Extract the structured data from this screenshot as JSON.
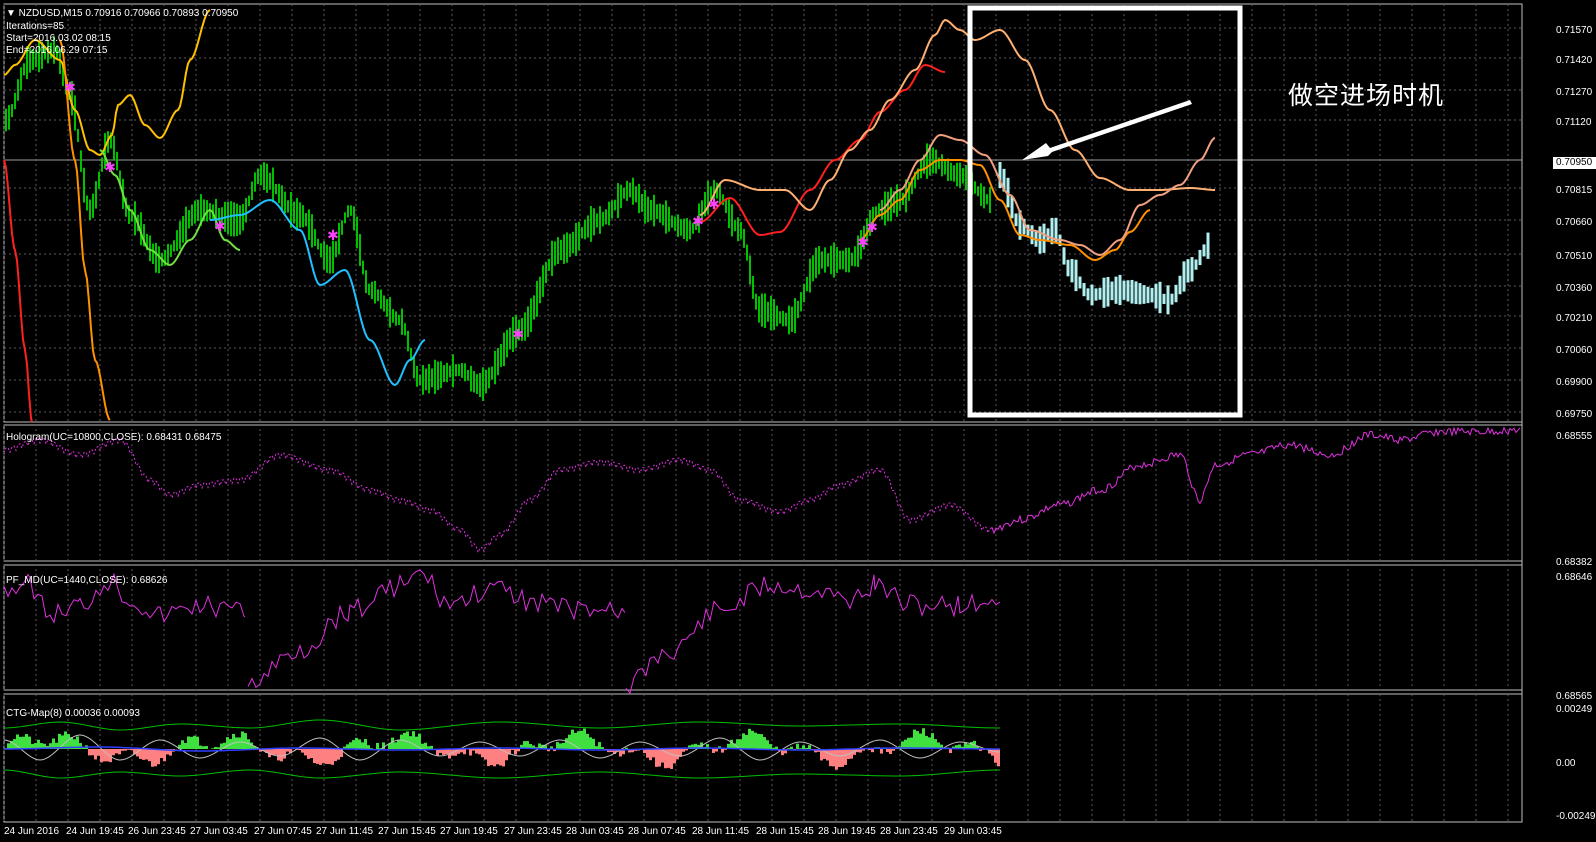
{
  "main": {
    "symbol_header": "▼ NZDUSD,M15  0.70916 0.70966 0.70893 0.70950",
    "iterations": "Iterations=85",
    "start": "Start=2016.03.02 08:15",
    "end": "End=2016.06.29 07:15",
    "price_labels": [
      "0.71570",
      "0.71420",
      "0.71270",
      "0.71120",
      "0.70950",
      "0.70815",
      "0.70660",
      "0.70510",
      "0.70360",
      "0.70210",
      "0.70060",
      "0.69900",
      "0.69750"
    ],
    "current_price": "0.70950",
    "annotation": "做空进场时机"
  },
  "hologram": {
    "header": "Hologram(UC=10800,CLOSE): 0.68431 0.68475",
    "labels": [
      "0.68555",
      "0.68382"
    ]
  },
  "pfmd": {
    "header": "PF_MD(UC=1440,CLOSE): 0.68626",
    "labels": [
      "0.68646",
      "0.68565"
    ]
  },
  "ctg": {
    "header": "CTG-Map(8) 0.00036 0.00093",
    "labels": [
      "0.00249",
      "0.00",
      "-0.00249"
    ]
  },
  "time_labels": [
    "24 Jun 2016",
    "24 Jun 19:45",
    "26 Jun 23:45",
    "27 Jun 03:45",
    "27 Jun 07:45",
    "27 Jun 11:45",
    "27 Jun 15:45",
    "27 Jun 19:45",
    "27 Jun 23:45",
    "28 Jun 03:45",
    "28 Jun 07:45",
    "28 Jun 11:45",
    "28 Jun 15:45",
    "28 Jun 19:45",
    "28 Jun 23:45",
    "29 Jun 03:45"
  ],
  "colors": {
    "background": "#000000",
    "grid": "#5a5a5a",
    "bars": "#00c000",
    "projection_bars": "#b0f0f0",
    "orange": "#ff9000",
    "red": "#ff2020",
    "cyan": "#20c0ff",
    "light_green": "#70e040",
    "salmon": "#f0a080",
    "peach": "#ffb070",
    "magenta": "#e030e0",
    "star": "#ff40ff",
    "highlight_box": "#ffffff"
  }
}
